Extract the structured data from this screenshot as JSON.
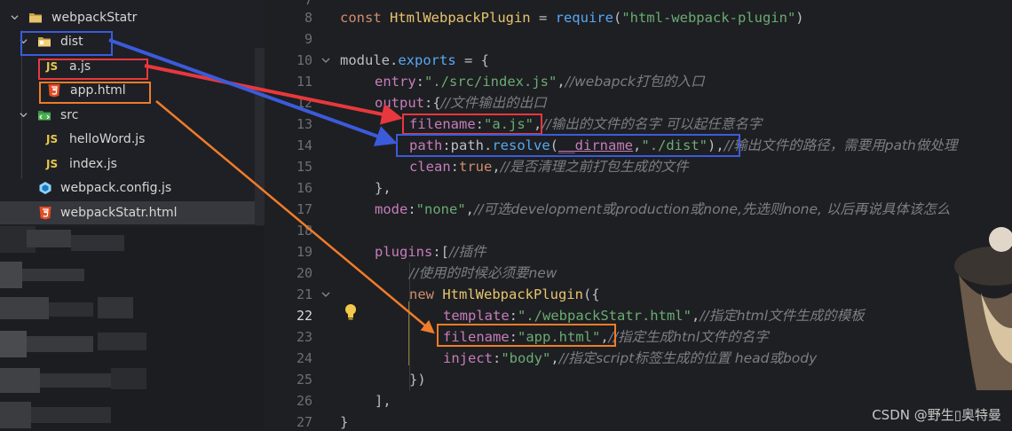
{
  "sidebar": {
    "items": [
      {
        "label": "webpackStatr",
        "type": "folder-open"
      },
      {
        "label": "dist",
        "type": "folder-open"
      },
      {
        "label": "a.js",
        "type": "js",
        "icon_text": "JS"
      },
      {
        "label": "app.html",
        "type": "html"
      },
      {
        "label": "src",
        "type": "folder-open"
      },
      {
        "label": "helloWord.js",
        "type": "js",
        "icon_text": "JS"
      },
      {
        "label": "index.js",
        "type": "js",
        "icon_text": "JS"
      },
      {
        "label": "webpack.config.js",
        "type": "config"
      },
      {
        "label": "webpackStatr.html",
        "type": "html",
        "selected": true
      }
    ]
  },
  "editor": {
    "current_line": "22",
    "line_numbers": [
      "7",
      "8",
      "9",
      "10",
      "11",
      "12",
      "13",
      "14",
      "15",
      "16",
      "17",
      "18",
      "19",
      "20",
      "21",
      "22",
      "23",
      "24",
      "25",
      "26",
      "27"
    ],
    "lines": {
      "l8": {
        "kw": "const ",
        "cls": "HtmlWebpackPlugin",
        "op": " = ",
        "fn": "require",
        "p1": "(",
        "str": "\"html-webpack-plugin\"",
        "p2": ")"
      },
      "l10": {
        "id": "module",
        "dot": ".",
        "prop": "exports",
        "rest": " = {"
      },
      "l11": {
        "prop": "entry",
        "colon": ":",
        "str": "\"./src/index.js\"",
        "comma": ",",
        "cmt": "//webapck打包的入口"
      },
      "l12": {
        "prop": "output",
        "colon": ":{",
        "cmt": "//文件输出的出口"
      },
      "l13": {
        "prop": "filename",
        "colon": ":",
        "str": "\"a.js\"",
        "comma": ",",
        "cmt": "//输出的文件的名字 可以起任意名字"
      },
      "l14": {
        "prop": "path",
        "colon": ":",
        "id": "path",
        "dot": ".",
        "fn": "resolve",
        "p1": "(",
        "dn": "__dirname",
        "c": ",",
        "str": "\"./dist\"",
        "p2": "),",
        "cmt": "//输出文件的路径，需要用path做处理"
      },
      "l15": {
        "prop": "clean",
        "colon": ":",
        "kw": "true",
        "comma": ",",
        "cmt": "//是否清理之前打包生成的文件"
      },
      "l16": {
        "text": "},"
      },
      "l17": {
        "prop": "mode",
        "colon": ":",
        "str": "\"none\"",
        "comma": ",",
        "cmt": "//可选development或production或none,先选则none, 以后再说具体该怎么"
      },
      "l19": {
        "prop": "plugins",
        "colon": ":[",
        "cmt": "//插件"
      },
      "l20": {
        "cmt": "//使用的时候必须要new"
      },
      "l21": {
        "kw": "new ",
        "cls": "HtmlWebpackPlugin",
        "rest": "({"
      },
      "l22": {
        "prop": "template",
        "colon": ":",
        "str": "\"./webpackStatr.html\"",
        "comma": ",",
        "cmt": "//指定html文件生成的模板"
      },
      "l23": {
        "prop": "filename",
        "colon": ":",
        "str": "\"app.html\"",
        "comma": ",",
        "cmt": "//指定生成htnl文件的名字"
      },
      "l24": {
        "prop": "inject",
        "colon": ":",
        "str": "\"body\"",
        "comma": ",",
        "cmt": "//指定script标签生成的位置 head或body"
      },
      "l25": {
        "text": "})"
      },
      "l26": {
        "text": "],"
      },
      "l27": {
        "text": "}"
      }
    }
  },
  "annotation_colors": {
    "red": "#e8383d",
    "blue": "#3b5bdb",
    "orange": "#f07c2a"
  },
  "watermark": "CSDN @野生▯奥特曼"
}
